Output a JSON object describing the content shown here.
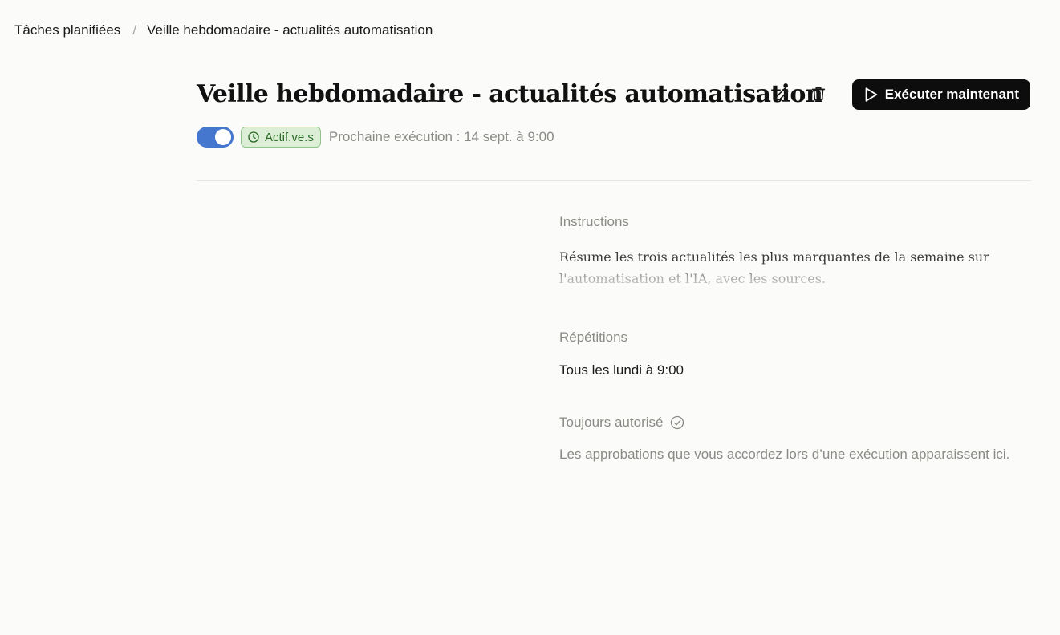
{
  "breadcrumb": {
    "parent": "Tâches planifiées",
    "separator": "/",
    "current": "Veille hebdomadaire - actualités automatisation"
  },
  "header": {
    "title": "Veille hebdomadaire - actualités automatisation",
    "edit_icon": "pencil-icon",
    "delete_icon": "trash-icon",
    "run_button_label": "Exécuter maintenant",
    "run_icon": "play-icon"
  },
  "status": {
    "toggle_on": true,
    "badge_label": "Actif.ve.s",
    "badge_icon": "clock-icon",
    "next_run": "Prochaine exécution : 14 sept. à 9:00"
  },
  "details": {
    "instructions_label": "Instructions",
    "instructions_text": "Résume les trois actualités les plus marquantes de la semaine sur l'automatisation et l'IA, avec les sources.",
    "repetitions_label": "Répétitions",
    "repetitions_value": "Tous les lundi à 9:00",
    "always_allowed_label": "Toujours autorisé",
    "always_allowed_icon": "check-circle-icon",
    "always_allowed_text": "Les approbations que vous accordez lors d’une exécution apparaissent ici."
  },
  "colors": {
    "background": "#fbfbf9",
    "accent": "#4577cf",
    "badge_bg": "#dcefd6",
    "badge_text": "#2a6a25",
    "button_bg": "#0d0d0d",
    "muted_text": "#8a8a86"
  }
}
